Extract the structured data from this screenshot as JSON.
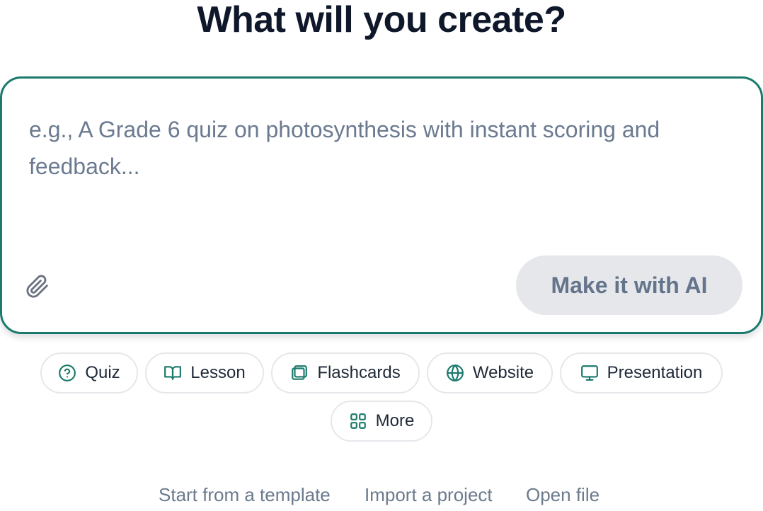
{
  "heading": "What will you create?",
  "composer": {
    "placeholder": "e.g., A Grade 6 quiz on photosynthesis with instant scoring and feedback...",
    "value": "",
    "attach_icon": "paperclip-icon",
    "submit_label": "Make it with AI",
    "submit_enabled": false
  },
  "chips": [
    {
      "label": "Quiz",
      "icon": "help-circle-icon"
    },
    {
      "label": "Lesson",
      "icon": "open-book-icon"
    },
    {
      "label": "Flashcards",
      "icon": "cards-icon"
    },
    {
      "label": "Website",
      "icon": "globe-icon"
    },
    {
      "label": "Presentation",
      "icon": "monitor-icon"
    },
    {
      "label": "More",
      "icon": "grid-icon"
    }
  ],
  "links": [
    {
      "label": "Start from a template"
    },
    {
      "label": "Import a project"
    },
    {
      "label": "Open file"
    }
  ],
  "colors": {
    "accent": "#1b7a6b",
    "heading": "#0f172a",
    "placeholder": "#6b7a90",
    "disabled_button_bg": "#e5e7eb",
    "disabled_button_text": "#64748b"
  }
}
